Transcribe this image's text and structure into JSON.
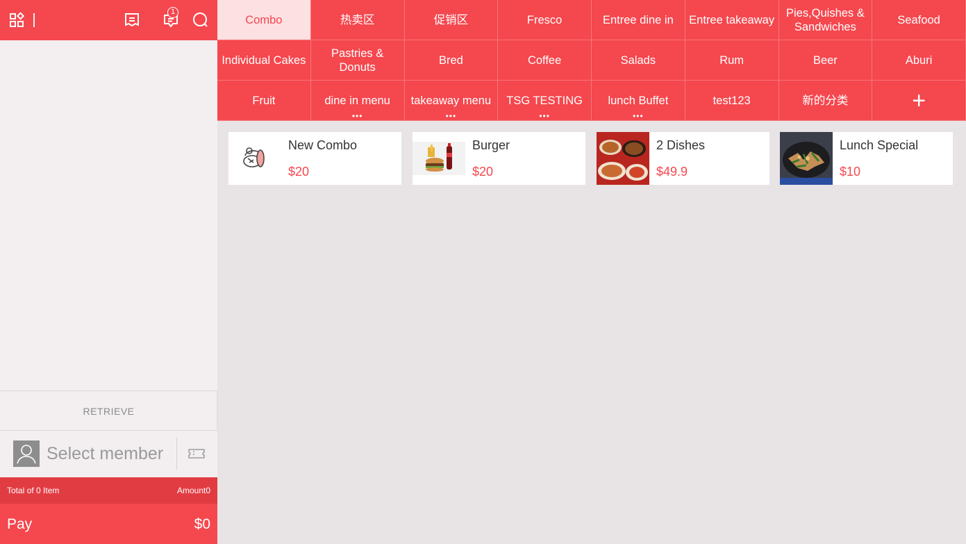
{
  "topbar": {
    "notification_count": "1"
  },
  "categories": [
    {
      "label": "Combo",
      "active": true
    },
    {
      "label": "热卖区"
    },
    {
      "label": "促销区"
    },
    {
      "label": "Fresco"
    },
    {
      "label": "Entree dine in"
    },
    {
      "label": "Entree takeaway"
    },
    {
      "label": "Pies,Quishes & Sandwiches"
    },
    {
      "label": "Seafood"
    },
    {
      "label": "Individual Cakes"
    },
    {
      "label": "Pastries & Donuts"
    },
    {
      "label": "Bred"
    },
    {
      "label": "Coffee"
    },
    {
      "label": "Salads"
    },
    {
      "label": "Rum"
    },
    {
      "label": "Beer"
    },
    {
      "label": "Aburi"
    },
    {
      "label": "Fruit"
    },
    {
      "label": "dine in menu",
      "more": true
    },
    {
      "label": "takeaway menu",
      "more": true
    },
    {
      "label": "TSG TESTING",
      "more": true
    },
    {
      "label": "lunch Buffet",
      "more": true
    },
    {
      "label": "test123"
    },
    {
      "label": "新的分类"
    }
  ],
  "more_marker": "•••",
  "add_category_symbol": "+",
  "products": [
    {
      "name": "New Combo",
      "price": "$20",
      "thumb": "combo-placeholder-icon"
    },
    {
      "name": "Burger",
      "price": "$20",
      "thumb": "burger-photo"
    },
    {
      "name": "2 Dishes",
      "price": "$49.9",
      "thumb": "dishes-photo"
    },
    {
      "name": "Lunch Special",
      "price": "$10",
      "thumb": "lunch-special-photo"
    }
  ],
  "left": {
    "retrieve_label": "RETRIEVE",
    "select_member_label": "Select member",
    "total_label": "Total of 0 Item",
    "amount_label": "Amount0",
    "pay_label": "Pay",
    "pay_amount": "$0"
  },
  "colors": {
    "brand_red": "#f5474e",
    "active_tab_bg": "#fde0e1"
  }
}
